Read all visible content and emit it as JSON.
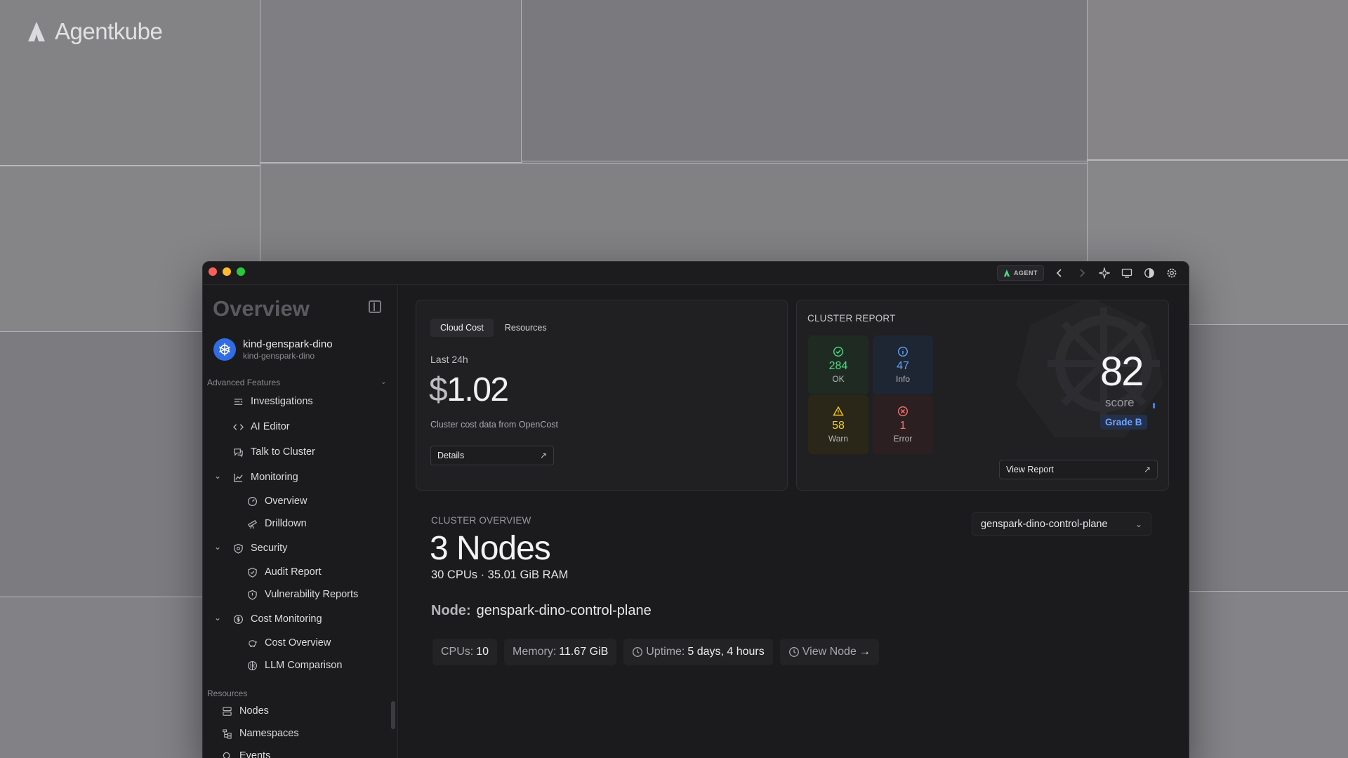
{
  "brand": {
    "name": "Agentkube"
  },
  "titlebar": {
    "agent_label": "AGENT"
  },
  "sidebar": {
    "title": "Overview",
    "cluster": {
      "name": "kind-genspark-dino",
      "context": "kind-genspark-dino"
    },
    "advanced_section": "Advanced Features",
    "items": [
      {
        "label": "Investigations",
        "icon": "list-icon"
      },
      {
        "label": "AI Editor",
        "icon": "code-icon"
      },
      {
        "label": "Talk to Cluster",
        "icon": "chat-icon"
      },
      {
        "label": "Monitoring",
        "icon": "chart-icon",
        "expanded": true
      },
      {
        "label": "Overview",
        "icon": "gauge-icon"
      },
      {
        "label": "Drilldown",
        "icon": "telescope-icon"
      },
      {
        "label": "Security",
        "icon": "shield-icon",
        "expanded": true
      },
      {
        "label": "Audit Report",
        "icon": "shield-check-icon"
      },
      {
        "label": "Vulnerability Reports",
        "icon": "shield-alert-icon"
      },
      {
        "label": "Cost Monitoring",
        "icon": "dollar-icon",
        "expanded": true
      },
      {
        "label": "Cost Overview",
        "icon": "piggy-bank-icon"
      },
      {
        "label": "LLM Comparison",
        "icon": "brain-icon"
      }
    ],
    "resources_section": "Resources",
    "resources": [
      {
        "label": "Nodes",
        "icon": "server-icon"
      },
      {
        "label": "Namespaces",
        "icon": "tree-icon"
      },
      {
        "label": "Events",
        "icon": "search-icon"
      }
    ]
  },
  "cost_card": {
    "tabs": [
      "Cloud Cost",
      "Resources"
    ],
    "period": "Last 24h",
    "currency": "$",
    "amount": "1.02",
    "source": "Cluster cost data from OpenCost",
    "details_label": "Details"
  },
  "report_card": {
    "title": "CLUSTER REPORT",
    "stats": [
      {
        "value": "284",
        "label": "OK",
        "color": "#4ade80",
        "bg": "#1f2a23"
      },
      {
        "value": "47",
        "label": "Info",
        "color": "#60a5fa",
        "bg": "#1e2533"
      },
      {
        "value": "58",
        "label": "Warn",
        "color": "#facc15",
        "bg": "#2a2719"
      },
      {
        "value": "1",
        "label": "Error",
        "color": "#f87171",
        "bg": "#2c1f21"
      }
    ],
    "score": "82",
    "score_label": "score",
    "grade": "Grade B",
    "view_report_label": "View Report"
  },
  "overview": {
    "label": "CLUSTER OVERVIEW",
    "nodes": "3 Nodes",
    "summary": "30 CPUs · 35.01 GiB RAM",
    "node_selector": "genspark-dino-control-plane",
    "node_label": "Node:",
    "node_name": "genspark-dino-control-plane",
    "cpus_label": "CPUs:",
    "cpus_value": "10",
    "memory_label": "Memory:",
    "memory_value": "11.67 GiB",
    "uptime_label": "Uptime:",
    "uptime_value": "5 days, 4 hours",
    "view_node_label": "View Node"
  }
}
